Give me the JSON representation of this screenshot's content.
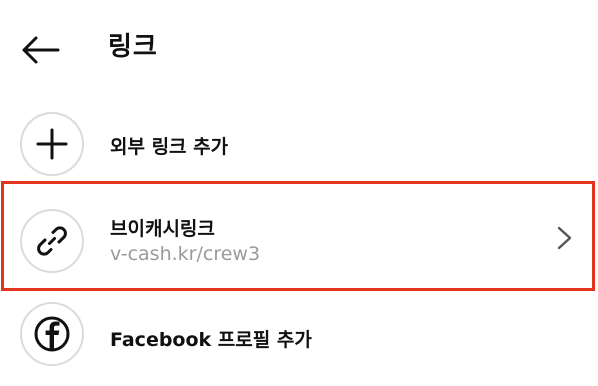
{
  "header": {
    "title": "링크",
    "back_icon": "arrow-left-icon"
  },
  "rows": {
    "add_external": {
      "label": "외부 링크 추가",
      "icon": "plus-icon"
    },
    "vcash_link": {
      "label": "브이캐시링크",
      "url": "v-cash.kr/crew3",
      "icon": "link-icon",
      "trailing_icon": "chevron-right-icon"
    },
    "facebook": {
      "label": "Facebook 프로필 추가",
      "icon": "facebook-icon"
    }
  },
  "colors": {
    "highlight_border": "#e2351f",
    "icon_border": "#dbdbdb",
    "secondary_text": "#9a9a9a"
  }
}
